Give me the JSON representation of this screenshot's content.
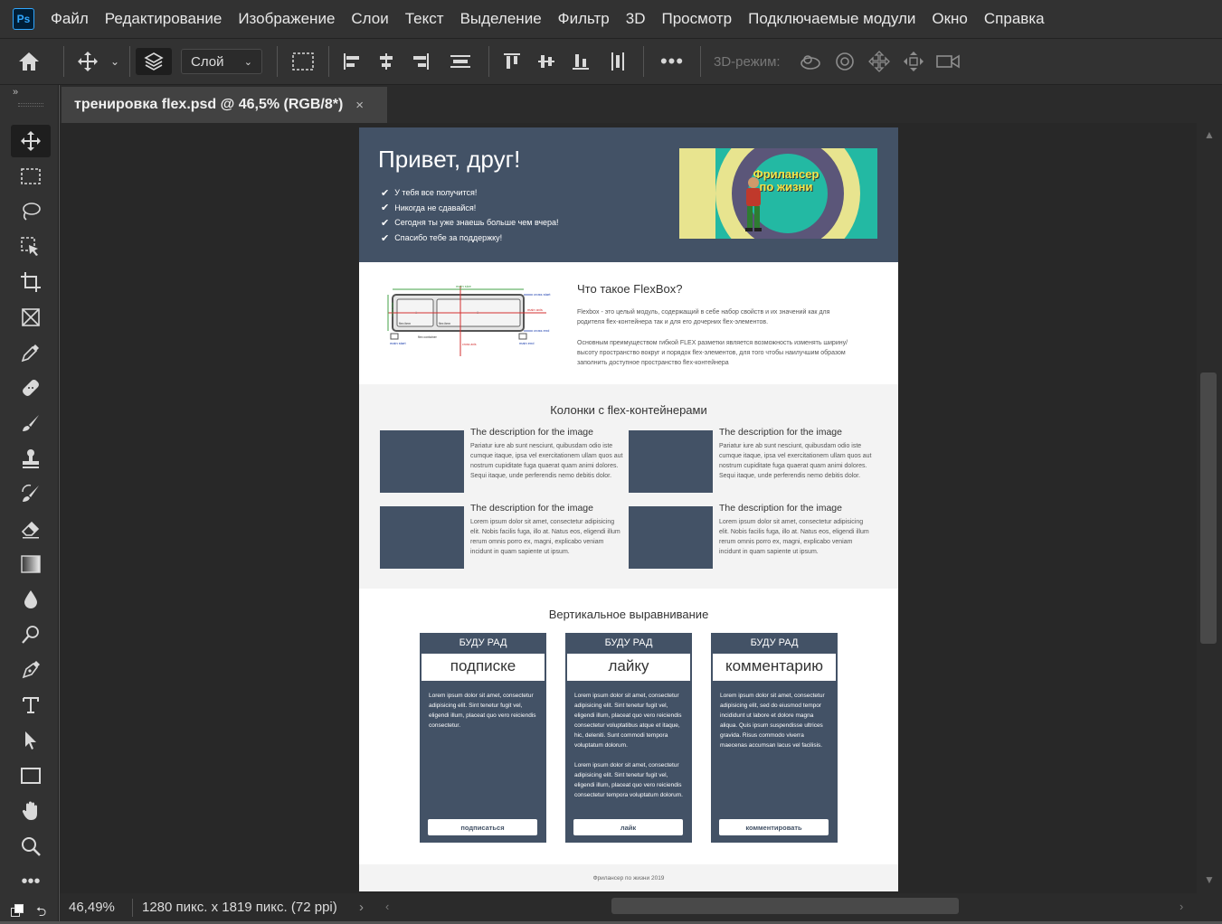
{
  "app": {
    "logo": "Ps",
    "menu": [
      "Файл",
      "Редактирование",
      "Изображение",
      "Слои",
      "Текст",
      "Выделение",
      "Фильтр",
      "3D",
      "Просмотр",
      "Подключаемые модули",
      "Окно",
      "Справка"
    ]
  },
  "options": {
    "layer_select": "Слой",
    "mode_label": "3D-режим:"
  },
  "tab": {
    "title": "тренировка flex.psd @ 46,5% (RGB/8*)",
    "close": "×"
  },
  "status": {
    "zoom": "46,49%",
    "doc_info": "1280 пикс. x 1819 пикс. (72 ppi)"
  },
  "doc": {
    "hero": {
      "title": "Привет, друг!",
      "checks": [
        "У тебя все получится!",
        "Никогда не сдавайся!",
        "Сегодня ты уже знаешь больше чем вчера!",
        "Спасибо тебе за поддержку!"
      ],
      "banner_text": "Фрилансер по жизни"
    },
    "flexbox": {
      "title": "Что такое FlexBox?",
      "p1": "Flexbox - это целый модуль, содержащий в себе набор свойств и их значений как для родителя flex-контейнера так и для его дочерних flex-элементов.",
      "p2": "Основным преимуществом гибкой FLEX разметки является возможность изменять ширину/высоту пространство вокруг и порядок flex-элементов, для того чтобы наилучшим образом заполнить доступное пространство flex-контейнера",
      "diagram_labels": {
        "main_size": "main size",
        "cross_start": "cross start",
        "main_axis": "main axis",
        "cross_end": "cross end",
        "flex_item": "flex item",
        "flex_container": "flex container",
        "cross_axis": "cross axis",
        "main_start": "main start",
        "main_end": "main end",
        "cross_size": "cross size",
        "n1": "1",
        "n2": "2"
      }
    },
    "columns": {
      "title": "Колонки с flex-контейнерами",
      "cards": [
        {
          "title": "The description for the image",
          "text": "Pariatur iure ab sunt nesciunt, quibusdam odio iste cumque itaque, ipsa vel exercitationem ullam quos aut nostrum cupiditate fuga quaerat quam animi dolores. Sequi itaque, unde perferendis nemo debitis dolor."
        },
        {
          "title": "The description for the image",
          "text": "Pariatur iure ab sunt nesciunt, quibusdam odio iste cumque itaque, ipsa vel exercitationem ullam quos aut nostrum cupiditate fuga quaerat quam animi dolores. Sequi itaque, unde perferendis nemo debitis dolor."
        },
        {
          "title": "The description for the image",
          "text": "Lorem ipsum dolor sit amet, consectetur adipisicing elit. Nobis facilis fuga, illo at. Natus eos, eligendi illum rerum omnis porro ex, magni, explicabo veniam incidunt in quam sapiente ut ipsum."
        },
        {
          "title": "The description for the image",
          "text": "Lorem ipsum dolor sit amet, consectetur adipisicing elit. Nobis facilis fuga, illo at. Natus eos, eligendi illum rerum omnis porro ex, magni, explicabo veniam incidunt in quam sapiente ut ipsum."
        }
      ]
    },
    "valign": {
      "title": "Вертикальное выравнивание",
      "cards": [
        {
          "head": "БУДУ РАД",
          "word": "подписке",
          "text": "Lorem ipsum dolor sit amet, consectetur adipisicing elit. Sint tenetur fugit vel, eligendi illum, placeat quo vero reiciendis consectetur.",
          "text2": "",
          "btn": "подписаться"
        },
        {
          "head": "БУДУ РАД",
          "word": "лайку",
          "text": "Lorem ipsum dolor sit amet, consectetur adipisicing elit. Sint tenetur fugit vel, eligendi illum, placeat quo vero reiciendis consectetur voluptatibus atque et itaque, hic, deleniti. Sunt commodi tempora voluptatum dolorum.",
          "text2": "Lorem ipsum dolor sit amet, consectetur adipisicing elit. Sint tenetur fugit vel, eligendi illum, placeat quo vero reiciendis consectetur tempora voluptatum dolorum.",
          "btn": "лайк"
        },
        {
          "head": "БУДУ РАД",
          "word": "комментарию",
          "text": "Lorem ipsum dolor sit amet, consectetur adipisicing elit, sed do eiusmod tempor incididunt ut labore et dolore magna aliqua. Quis ipsum suspendisse ultrices gravida. Risus commodo viverra maecenas accumsan lacus vel facilisis.",
          "text2": "",
          "btn": "комментировать"
        }
      ]
    },
    "footer": "Фрилансер по жизни 2019"
  }
}
